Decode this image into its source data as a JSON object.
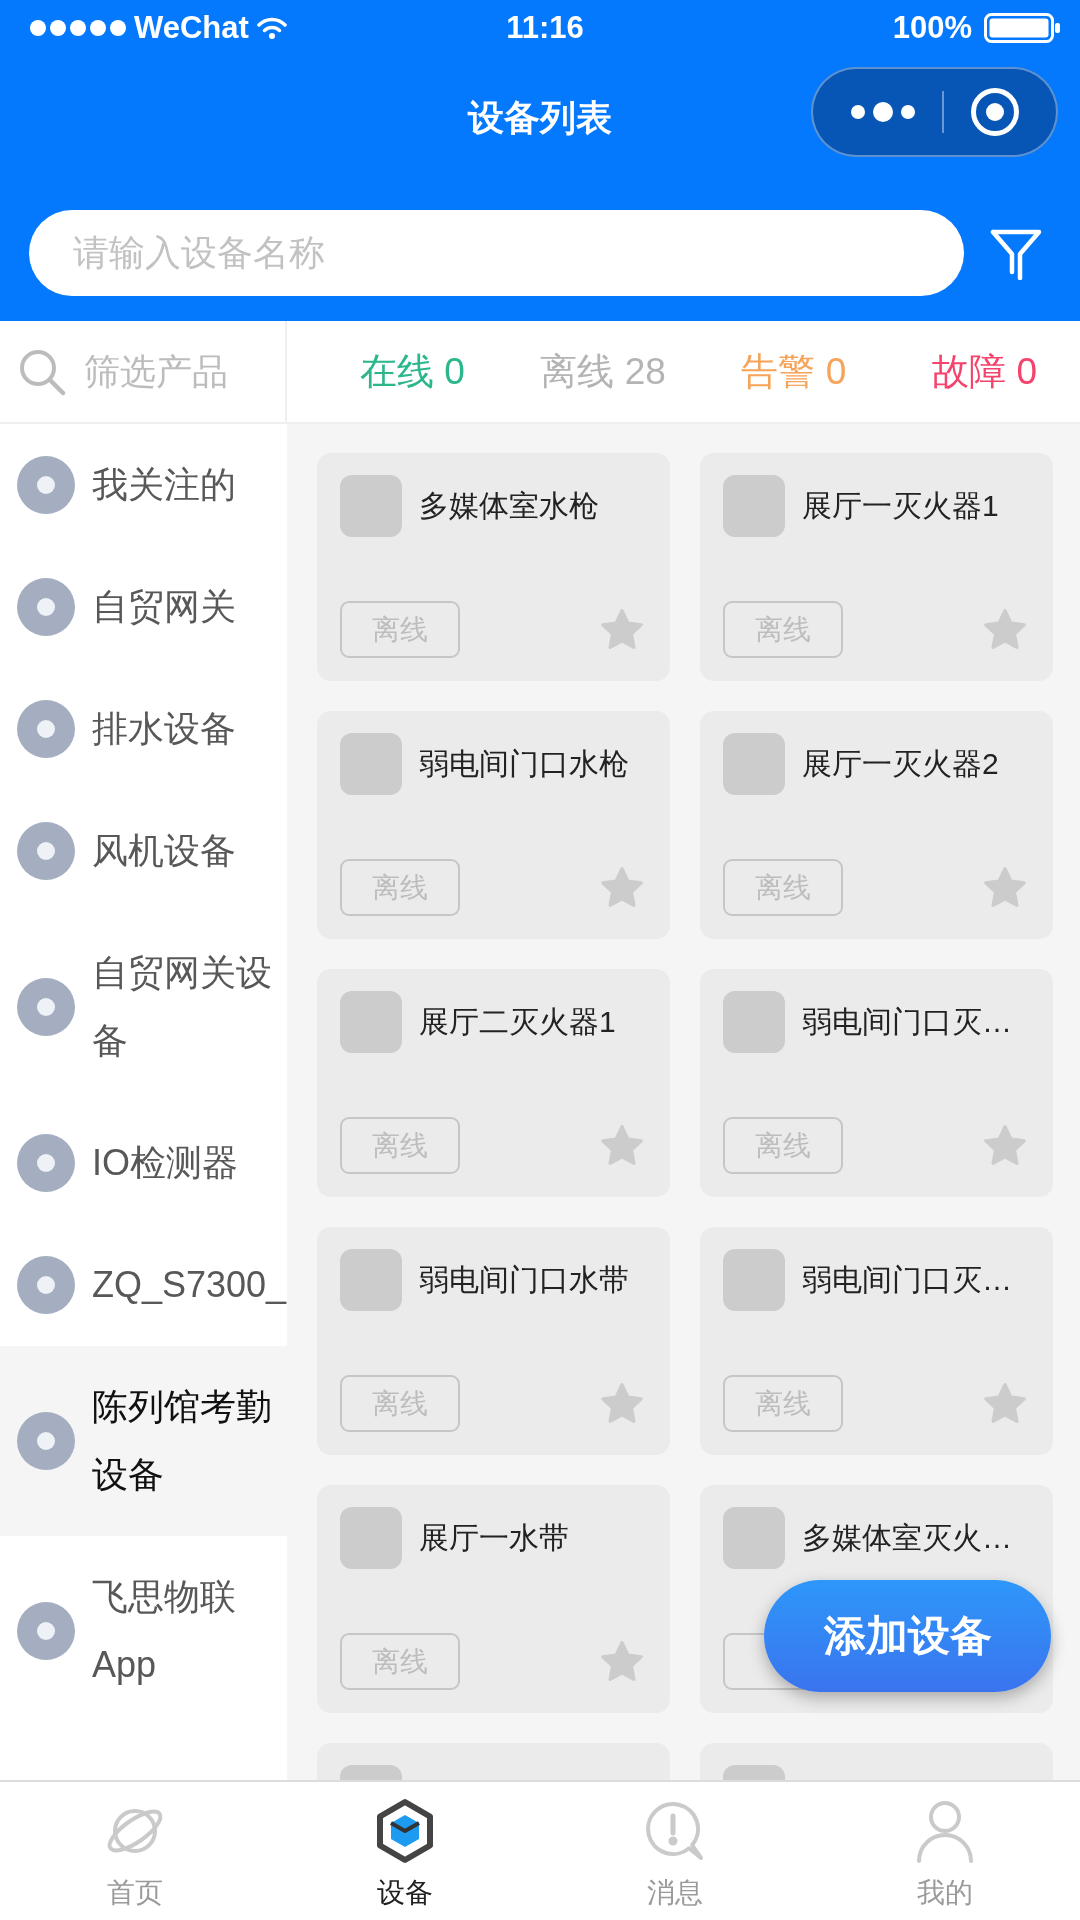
{
  "status_bar": {
    "carrier": "WeChat",
    "time": "11:16",
    "battery": "100%"
  },
  "nav_bar": {
    "title": "设备列表"
  },
  "search": {
    "placeholder": "请输入设备名称"
  },
  "product_filter": {
    "placeholder": "筛选产品"
  },
  "status_tabs": [
    {
      "label": "在线",
      "count": "0",
      "color": "#2bb68c"
    },
    {
      "label": "离线",
      "count": "28",
      "color": "#b4b4b4"
    },
    {
      "label": "告警",
      "count": "0",
      "color": "#f7a45b"
    },
    {
      "label": "故障",
      "count": "0",
      "color": "#f4436c"
    }
  ],
  "categories": [
    {
      "name": "我关注的",
      "selected": false
    },
    {
      "name": "自贸网关",
      "selected": false
    },
    {
      "name": "排水设备",
      "selected": false
    },
    {
      "name": "风机设备",
      "selected": false
    },
    {
      "name": "自贸网关设备",
      "selected": false
    },
    {
      "name": "IO检测器",
      "selected": false
    },
    {
      "name": "ZQ_S7300_",
      "selected": false
    },
    {
      "name": "陈列馆考勤设备",
      "selected": true
    },
    {
      "name": "飞思物联App",
      "selected": false
    }
  ],
  "devices": [
    {
      "kind": "card",
      "name": "多媒体室水枪",
      "status": "离线",
      "favorite": false
    },
    {
      "kind": "card",
      "name": "展厅一灭火器1",
      "status": "离线",
      "favorite": false
    },
    {
      "kind": "card",
      "name": "弱电间门口水枪",
      "status": "离线",
      "favorite": false
    },
    {
      "kind": "card",
      "name": "展厅一灭火器2",
      "status": "离线",
      "favorite": false
    },
    {
      "kind": "card",
      "name": "展厅二灭火器1",
      "status": "离线",
      "favorite": false
    },
    {
      "kind": "card",
      "name": "弱电间门口灭…",
      "status": "离线",
      "favorite": false
    },
    {
      "kind": "card",
      "name": "弱电间门口水带",
      "status": "离线",
      "favorite": false
    },
    {
      "kind": "card",
      "name": "弱电间门口灭…",
      "status": "离线",
      "favorite": false
    },
    {
      "kind": "card",
      "name": "展厅一水带",
      "status": "离线",
      "favorite": false
    },
    {
      "kind": "card",
      "name": "多媒体室灭火…"
    },
    {
      "kind": "peek"
    },
    {
      "kind": "peek"
    }
  ],
  "add_button": {
    "label": "添加设备"
  },
  "tab_bar": [
    {
      "label": "首页",
      "selected": false
    },
    {
      "label": "设备",
      "selected": true
    },
    {
      "label": "消息",
      "selected": false
    },
    {
      "label": "我的",
      "selected": false
    }
  ]
}
